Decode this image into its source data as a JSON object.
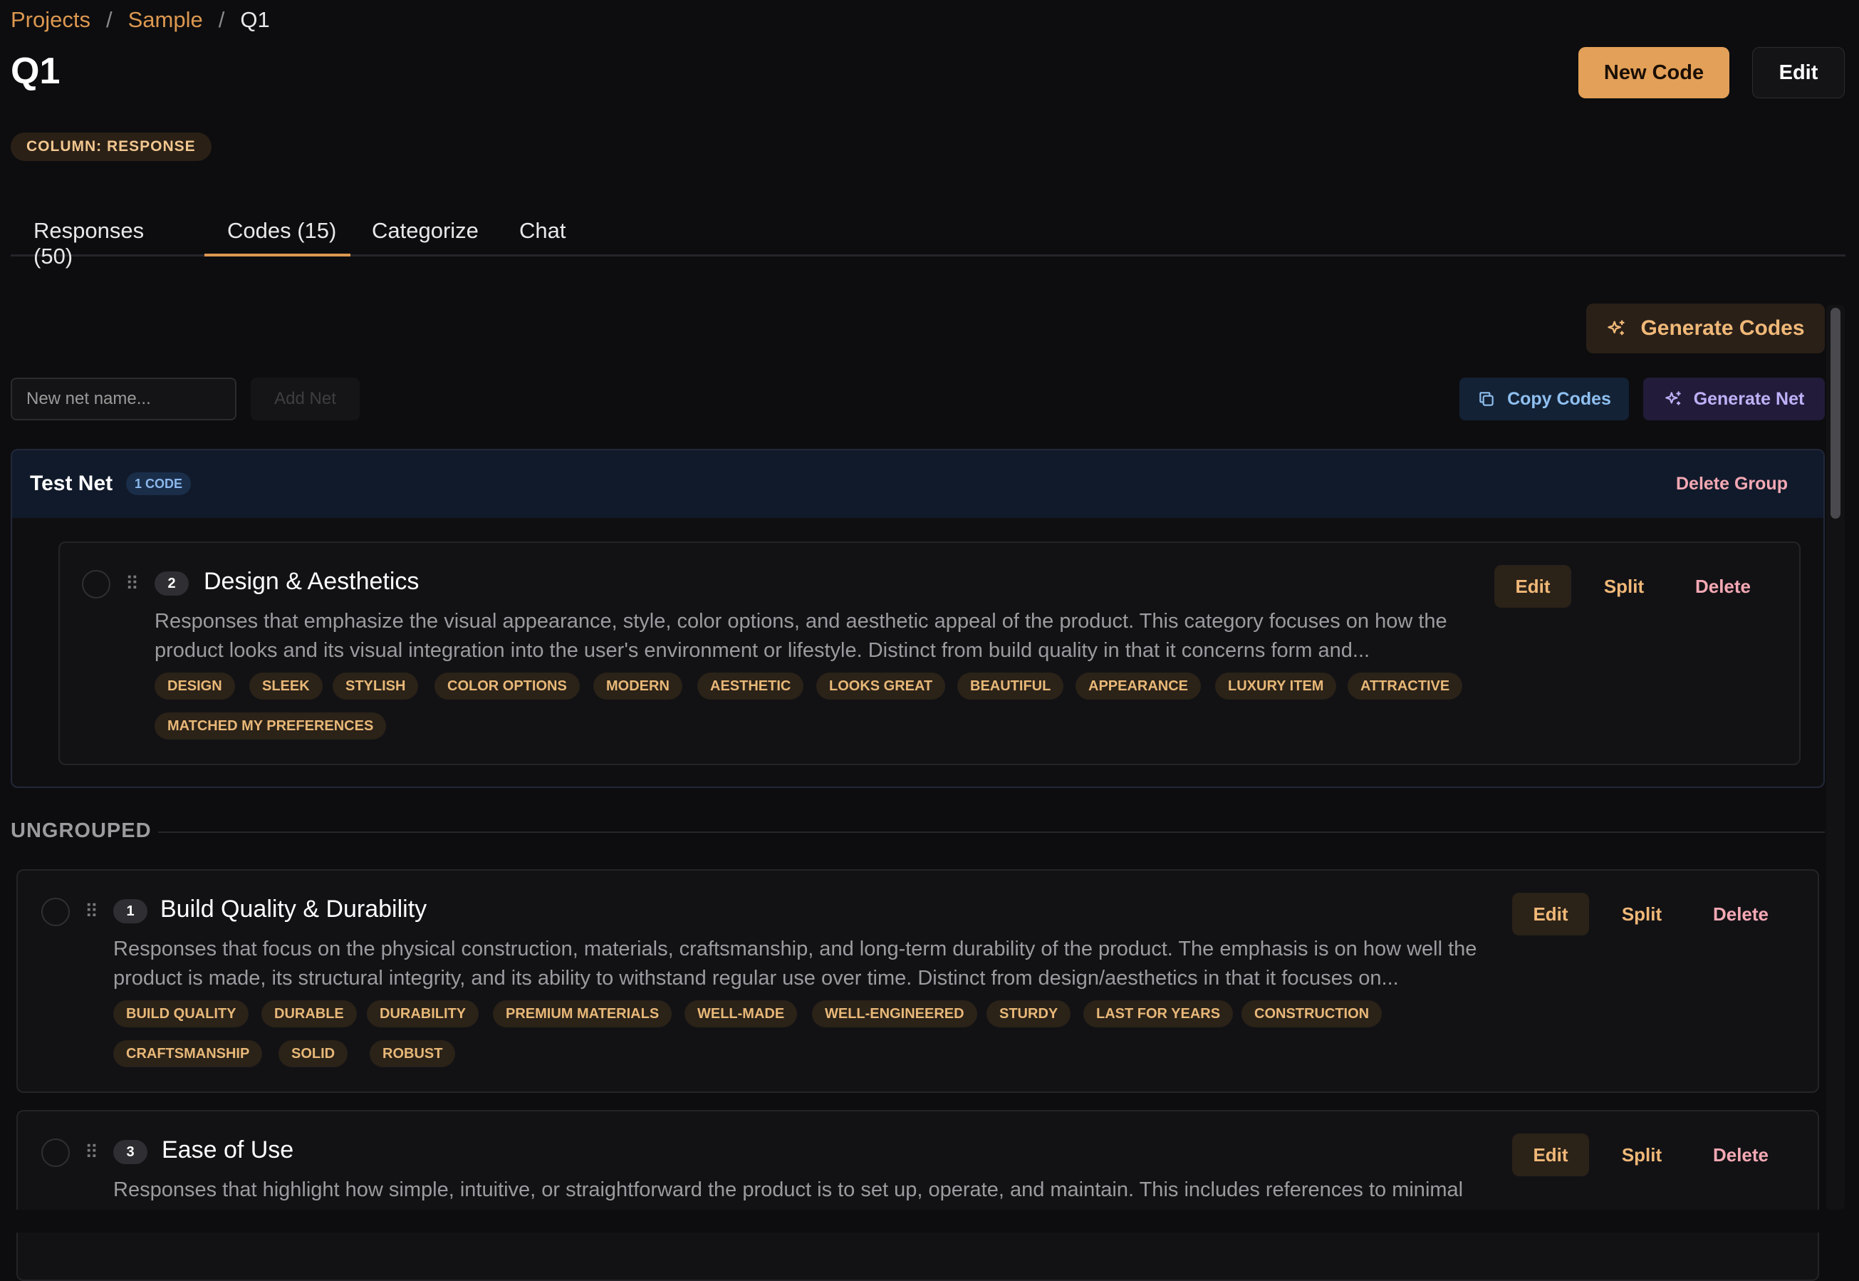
{
  "breadcrumb": {
    "items": [
      "Projects",
      "Sample",
      "Q1"
    ],
    "separator": "/"
  },
  "page": {
    "title": "Q1",
    "column_badge": "COLUMN: RESPONSE"
  },
  "header_actions": {
    "new_code": "New Code",
    "edit": "Edit"
  },
  "tabs": [
    {
      "label": "Responses (50)",
      "active": false
    },
    {
      "label": "Codes (15)",
      "active": true
    },
    {
      "label": "Categorize",
      "active": false
    },
    {
      "label": "Chat",
      "active": false
    }
  ],
  "toolbar": {
    "generate_codes": "Generate Codes",
    "net_input_placeholder": "New net name...",
    "add_net": "Add Net",
    "copy_codes": "Copy Codes",
    "generate_net": "Generate Net"
  },
  "groups": [
    {
      "name": "Test Net",
      "count_badge": "1 CODE",
      "delete_label": "Delete Group"
    }
  ],
  "ungrouped_label": "UNGROUPED",
  "code_actions": {
    "edit": "Edit",
    "split": "Split",
    "delete": "Delete"
  },
  "codes": [
    {
      "number": "2",
      "title": "Design & Aesthetics",
      "description": "Responses that emphasize the visual appearance, style, color options, and aesthetic appeal of the product. This category focuses on how the product looks and its visual integration into the user's environment or lifestyle. Distinct from build quality in that it concerns form and...",
      "keywords": [
        "DESIGN",
        "SLEEK",
        "STYLISH",
        "COLOR OPTIONS",
        "MODERN",
        "AESTHETIC",
        "LOOKS GREAT",
        "BEAUTIFUL",
        "APPEARANCE",
        "LUXURY ITEM",
        "ATTRACTIVE",
        "MATCHED MY PREFERENCES"
      ]
    },
    {
      "number": "1",
      "title": "Build Quality & Durability",
      "description": "Responses that focus on the physical construction, materials, craftsmanship, and long-term durability of the product. The emphasis is on how well the product is made, its structural integrity, and its ability to withstand regular use over time. Distinct from design/aesthetics in that it focuses on...",
      "keywords": [
        "BUILD QUALITY",
        "DURABLE",
        "DURABILITY",
        "PREMIUM MATERIALS",
        "WELL-MADE",
        "WELL-ENGINEERED",
        "STURDY",
        "LAST FOR YEARS",
        "CONSTRUCTION",
        "CRAFTSMANSHIP",
        "SOLID",
        "ROBUST"
      ]
    },
    {
      "number": "3",
      "title": "Ease of Use",
      "description": "Responses that highlight how simple, intuitive, or straightforward the product is to set up, operate, and maintain. This includes references to minimal",
      "keywords": []
    }
  ],
  "colors": {
    "accent": "#e3a058",
    "background": "#0d0d0f",
    "delete": "#f4a8b4",
    "info": "#8fc0f0",
    "violet": "#c0b0f8"
  }
}
